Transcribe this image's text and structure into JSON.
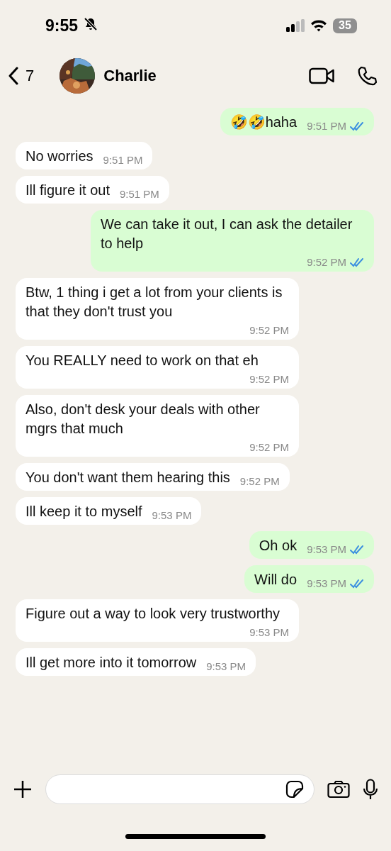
{
  "status_bar": {
    "time": "9:55",
    "muted": true,
    "battery": "35"
  },
  "header": {
    "back_count": "7",
    "contact": "Charlie"
  },
  "messages": [
    {
      "kind": "out",
      "text": "🤣🤣haha",
      "time": "9:51 PM",
      "read": true
    },
    {
      "kind": "in",
      "text": "No worries",
      "time": "9:51 PM"
    },
    {
      "kind": "in",
      "text": "Ill figure it out",
      "time": "9:51 PM"
    },
    {
      "kind": "out",
      "text": "We can take it out, I can ask the detailer to help",
      "time": "9:52 PM",
      "read": true
    },
    {
      "kind": "in",
      "text": "Btw, 1 thing i get a lot from your clients is that they don't trust you",
      "time": "9:52 PM"
    },
    {
      "kind": "in",
      "text": "You REALLY need to work on that eh",
      "time": "9:52 PM"
    },
    {
      "kind": "in",
      "text": "Also, don't desk your deals with other mgrs that much",
      "time": "9:52 PM"
    },
    {
      "kind": "in",
      "text": "You don't want them hearing this",
      "time": "9:52 PM"
    },
    {
      "kind": "in",
      "text": "Ill keep it to myself",
      "time": "9:53 PM"
    },
    {
      "kind": "out",
      "text": "Oh ok",
      "time": "9:53 PM",
      "read": true
    },
    {
      "kind": "out",
      "text": "Will do",
      "time": "9:53 PM",
      "read": true
    },
    {
      "kind": "in",
      "text": "Figure out a way to look very trustworthy",
      "time": "9:53 PM"
    },
    {
      "kind": "in",
      "text": "Ill get more into it tomorrow",
      "time": "9:53 PM"
    }
  ]
}
